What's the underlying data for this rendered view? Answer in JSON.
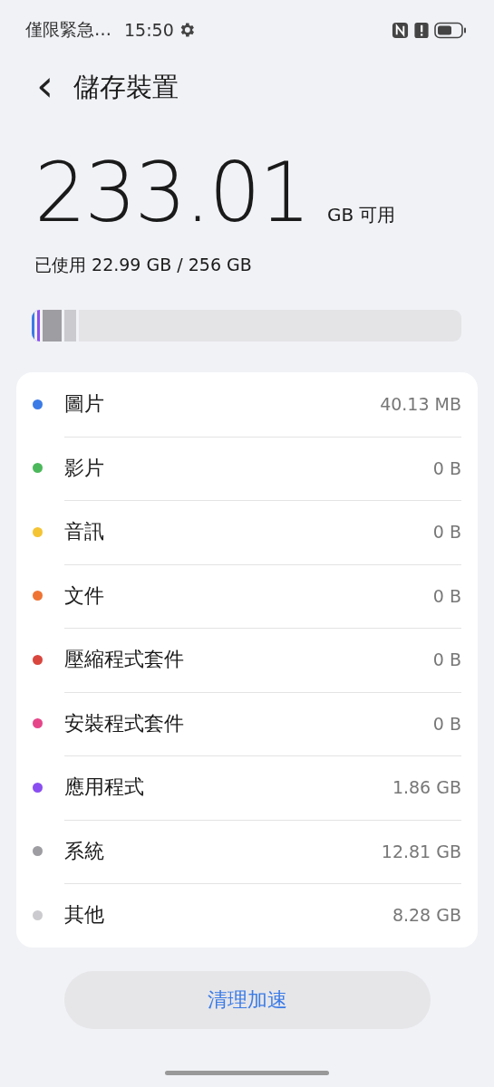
{
  "status_bar": {
    "carrier": "僅限緊急…",
    "time": "15:50"
  },
  "header": {
    "back": "‹",
    "title": "儲存裝置"
  },
  "summary": {
    "free": "233.01",
    "free_unit": "GB 可用",
    "used": "已使用 22.99 GB / 256 GB"
  },
  "usage_bar": {
    "segments": [
      {
        "color": "#3b7be6",
        "level": 0.013
      },
      {
        "color": "#8a4ef0",
        "level": 0.013
      },
      {
        "color": "#9d9da2",
        "level": 0.05
      },
      {
        "color": "#cbcbcf",
        "level": 0.033
      }
    ]
  },
  "categories": [
    {
      "label": "圖片",
      "size": "40.13 MB",
      "color": "#3b7be6"
    },
    {
      "label": "影片",
      "size": "0 B",
      "color": "#4cb85c"
    },
    {
      "label": "音訊",
      "size": "0 B",
      "color": "#f4c434"
    },
    {
      "label": "文件",
      "size": "0 B",
      "color": "#ef7434"
    },
    {
      "label": "壓縮程式套件",
      "size": "0 B",
      "color": "#d9463e"
    },
    {
      "label": "安裝程式套件",
      "size": "0 B",
      "color": "#e5468a"
    },
    {
      "label": "應用程式",
      "size": "1.86 GB",
      "color": "#8a4ef0"
    },
    {
      "label": "系統",
      "size": "12.81 GB",
      "color": "#9d9da2"
    },
    {
      "label": "其他",
      "size": "8.28 GB",
      "color": "#cbcbcf"
    }
  ],
  "action_button": "清理加速"
}
